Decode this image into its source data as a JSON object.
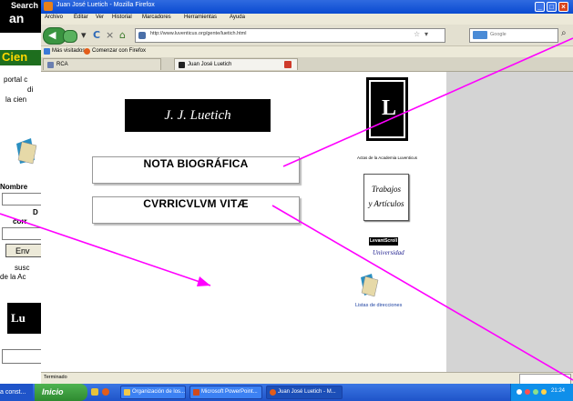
{
  "background_page": {
    "search_label": "Search",
    "amazon_label": "an",
    "section_heading": "Cien",
    "lines": [
      "portal c",
      "di",
      "la cien"
    ],
    "name_label": "Nombre",
    "d_label": "D",
    "corr_label": "corr",
    "send_button": "Env",
    "subscribe_lines": [
      "susc",
      "de la Ac"
    ],
    "logo_text": "Lu"
  },
  "window": {
    "title": "Juan José Luetich - Mozilla Firefox",
    "menu": [
      "Archivo",
      "Editar",
      "Ver",
      "Historial",
      "Marcadores",
      "Herramientas",
      "Ayuda"
    ],
    "url": "http://www.luventicus.org/gente/luetich.html",
    "search_placeholder": "Google",
    "bookmarks": [
      "Más visitados",
      "Comenzar con Firefox"
    ],
    "tabs": [
      {
        "label": "RCA"
      },
      {
        "label": "Juan José Luetich"
      }
    ],
    "status": "Terminado"
  },
  "content": {
    "brand": "J. J. Luetich",
    "bio_button": "NOTA BIOGRÁFICA",
    "cv_button": "CVRRICVLVM VITÆ",
    "logo_letter": "L",
    "academy_caption": "Actas de la Academia Luventicus",
    "trabajos_line1": "Trabajos",
    "trabajos_line2": "y Artículos",
    "leventscroll": "LevantScroll",
    "universidad": "Universidad",
    "listas_caption": "Listas de direcciones"
  },
  "taskbar": {
    "left_item": "a const...",
    "start": "Inicio",
    "items": [
      "Organización de los...",
      "Microsoft PowerPoint...",
      "Juan José Luetich - M..."
    ],
    "clock": "21:24"
  },
  "colors": {
    "annotation": "#ff00ff",
    "titlebar": "#0a4bd1",
    "taskbar": "#1f54c9"
  }
}
